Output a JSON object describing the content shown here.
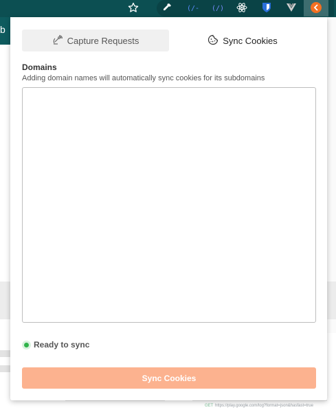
{
  "browser": {
    "toolbar_icons": [
      "star-icon",
      "eyedropper-icon",
      "api-icon",
      "api-icon-2",
      "react-icon",
      "bitwarden-icon",
      "vue-icon",
      "capture-extension-icon"
    ],
    "page_tab_fragment": "b",
    "page_request_method": "GET",
    "page_request_url": "https://play.google.com/log?format=json&hasfast=true"
  },
  "popup": {
    "tabs": [
      {
        "label": "Capture Requests",
        "icon": "satellite-icon",
        "active": false
      },
      {
        "label": "Sync Cookies",
        "icon": "cookie-icon",
        "active": true
      }
    ],
    "domains": {
      "title": "Domains",
      "description": "Adding domain names will automatically sync cookies for its subdomains",
      "value": ""
    },
    "status": {
      "text": "Ready to sync",
      "color": "#2fb34a"
    },
    "sync_button": {
      "label": "Sync Cookies",
      "color": "#fcb28f"
    }
  }
}
